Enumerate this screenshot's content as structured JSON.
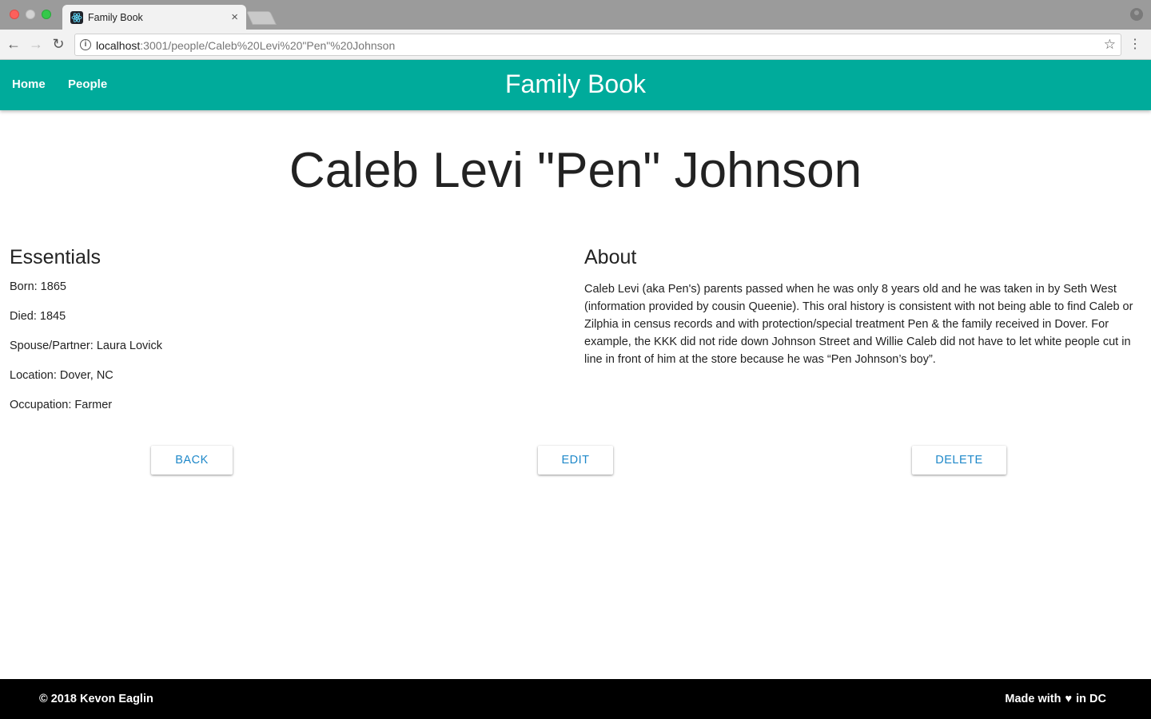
{
  "browser": {
    "tab_title": "Family Book",
    "tab_close": "×",
    "url_host": "localhost",
    "url_path": ":3001/people/Caleb%20Levi%20\"Pen\"%20Johnson"
  },
  "nav": {
    "home": "Home",
    "people": "People",
    "brand": "Family Book"
  },
  "person": {
    "name": "Caleb Levi \"Pen\" Johnson"
  },
  "essentials": {
    "heading": "Essentials",
    "born": "Born: 1865",
    "died": "Died: 1845",
    "spouse": "Spouse/Partner: Laura Lovick",
    "location": "Location: Dover, NC",
    "occupation": "Occupation: Farmer"
  },
  "about": {
    "heading": "About",
    "text": "Caleb Levi (aka Pen's) parents passed when he was only 8 years old and he was taken in by Seth West (information provided by cousin Queenie). This oral history is consistent with not being able to find Caleb or Zilphia in census records and with protection/special treatment Pen & the family received in Dover. For example, the KKK did not ride down Johnson Street and Willie Caleb did not have to let white people cut in line in front of him at the store because he was “Pen Johnson’s boy”."
  },
  "actions": {
    "back": "BACK",
    "edit": "EDIT",
    "delete": "DELETE"
  },
  "footer": {
    "copyright": "© 2018 Kevon Eaglin",
    "made_with_prefix": "Made with",
    "heart": "♥",
    "made_with_suffix": "in DC"
  },
  "colors": {
    "appbar": "#00ab9b",
    "button_text": "#1e88c9",
    "footer": "#000000"
  },
  "icons": [
    "react-favicon-icon",
    "close-icon",
    "profile-icon",
    "back-arrow-icon",
    "forward-arrow-icon",
    "reload-icon",
    "info-icon",
    "star-icon",
    "menu-icon",
    "heart-icon"
  ]
}
